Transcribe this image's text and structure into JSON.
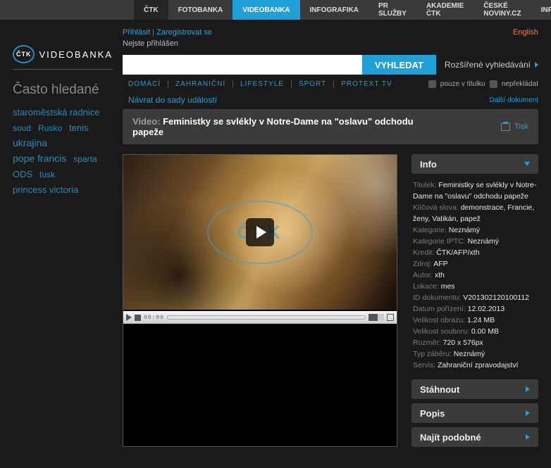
{
  "topnav": {
    "items": [
      {
        "label": "ČTK",
        "variant": "dark"
      },
      {
        "label": "FOTOBANKA",
        "variant": ""
      },
      {
        "label": "VIDEOBANKA",
        "variant": "blue"
      },
      {
        "label": "INFOGRAFIKA",
        "variant": ""
      },
      {
        "label": "PR SLUŽBY",
        "variant": ""
      },
      {
        "label": "AKADEMIE ČTK",
        "variant": ""
      },
      {
        "label": "ČESKÉ NOVINY.CZ",
        "variant": ""
      },
      {
        "label": "INFOBANKA",
        "variant": ""
      }
    ]
  },
  "brand": {
    "mark": "ČTK",
    "text": "VIDEOBANKA"
  },
  "sidebar": {
    "heading": "Často hledané",
    "tags": [
      "staroměstská radnice",
      "soud",
      "Rusko",
      "tenis",
      "ukrajina",
      "pope francis",
      "sparta",
      "ODS",
      "tusk",
      "princess victoria"
    ]
  },
  "auth": {
    "login": "Přihlásit",
    "sep": " | ",
    "register": "Zaregistrovat se",
    "status": "Nejste přihlášen",
    "lang": "English"
  },
  "search": {
    "placeholder": "",
    "button": "VYHLEDAT",
    "advanced": "Rozšířené vyhledávání",
    "chk1": "pouze v titulku",
    "chk2": "nepřekládat"
  },
  "catnav": [
    "DOMÁCÍ",
    "ZAHRANIČNÍ",
    "LIFESTYLE",
    "SPORT",
    "PROTEXT TV"
  ],
  "mid": {
    "back": "Návrat do sady událostí",
    "next": "Další dokument"
  },
  "title": {
    "prefix": "Video: ",
    "text": "Feministky se svlékly v Notre-Dame na \"oslavu\" odchodu papeže",
    "print": "Tisk"
  },
  "player": {
    "watermark": "ČTK",
    "time": "00:00"
  },
  "panels": {
    "info": "Info",
    "download": "Stáhnout",
    "desc": "Popis",
    "similar": "Najít podobné"
  },
  "info": [
    {
      "k": "Titulek: ",
      "v": "Feministky se svlékly v Notre-Dame na \"oslavu\" odchodu papeže"
    },
    {
      "k": "Klíčová slova: ",
      "v": "demonstrace, Francie, ženy, Vatikán, papež"
    },
    {
      "k": "Kategorie: ",
      "v": "Neznámý"
    },
    {
      "k": "Kategorie IPTC: ",
      "v": "Neznámý"
    },
    {
      "k": "Kredit: ",
      "v": "ČTK/AFP/xth"
    },
    {
      "k": "Zdroj: ",
      "v": "AFP"
    },
    {
      "k": "Autor: ",
      "v": "xth"
    },
    {
      "k": "Lokace: ",
      "v": "mes"
    },
    {
      "k": "ID dokumentu: ",
      "v": "V201302120100112"
    },
    {
      "k": "Datum pořízení: ",
      "v": "12.02.2013"
    },
    {
      "k": "Velikost obrazu: ",
      "v": "1.24 MB"
    },
    {
      "k": "Velikost souboru: ",
      "v": "0.00 MB"
    },
    {
      "k": "Rozměr: ",
      "v": "720 x 576px"
    },
    {
      "k": "Typ záběru: ",
      "v": "Neznámý"
    },
    {
      "k": "Servis: ",
      "v": "Zahraniční zpravodajství"
    }
  ]
}
